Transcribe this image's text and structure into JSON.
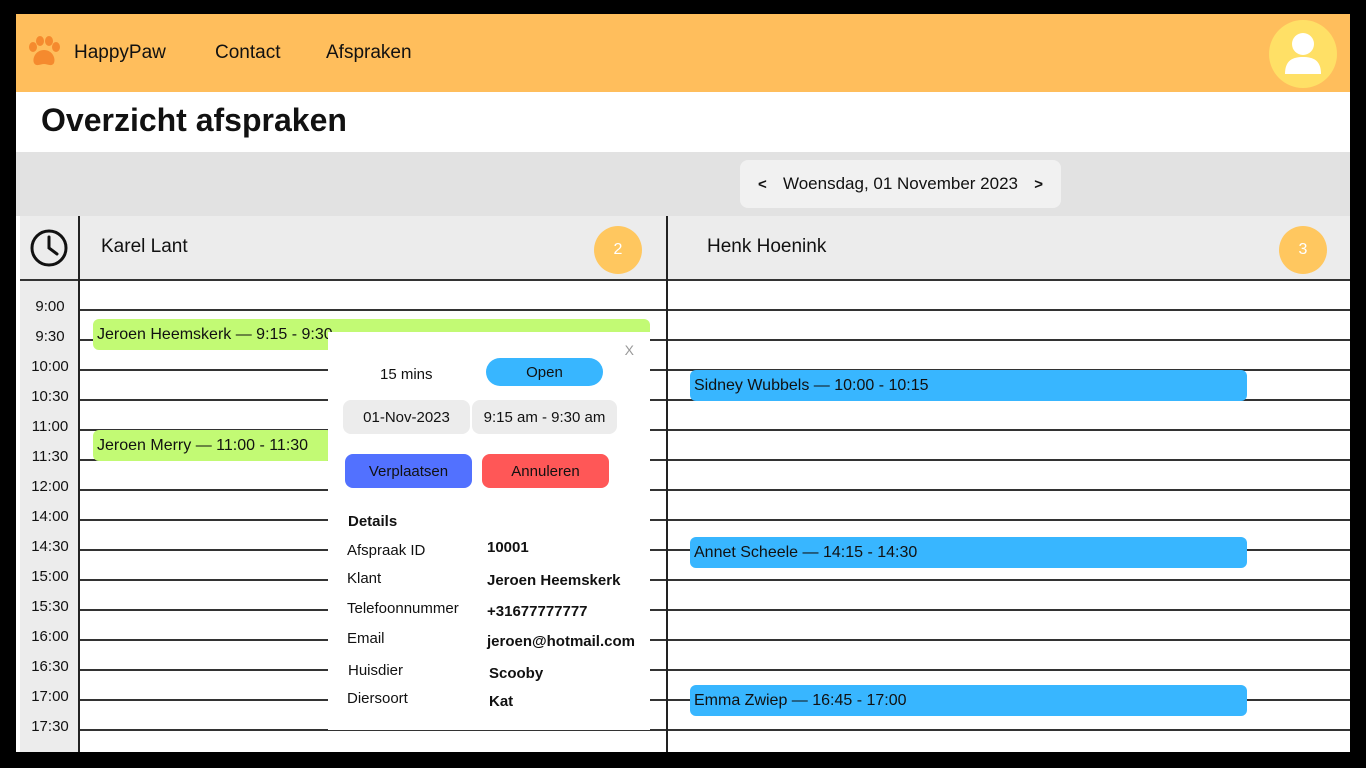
{
  "app": {
    "brand": "HappyPaw"
  },
  "nav": {
    "contact": "Contact",
    "afspraken": "Afspraken"
  },
  "page": {
    "title": "Overzicht afspraken"
  },
  "datebar": {
    "prev": "<",
    "date": "Woensdag, 01 November 2023",
    "next": ">"
  },
  "colors": {
    "header": "#ffbe5c",
    "badge": "#ffc75f",
    "green": "#c2fa74",
    "blue": "#38b6ff",
    "move": "#5271ff",
    "cancel": "#ff5757"
  },
  "staff": [
    {
      "name": "Karel Lant",
      "count": "2"
    },
    {
      "name": "Henk Hoenink",
      "count": "3"
    }
  ],
  "times": [
    "9:00",
    "9:30",
    "10:00",
    "10:30",
    "11:00",
    "11:30",
    "12:00",
    "14:00",
    "14:30",
    "15:00",
    "15:30",
    "16:00",
    "16:30",
    "17:00",
    "17:30"
  ],
  "appointments": {
    "karel": [
      {
        "label": "Jeroen Heemskerk — 9:15 - 9:30"
      },
      {
        "label": "Jeroen Merry — 11:00 - 11:30"
      }
    ],
    "henk": [
      {
        "label": "Sidney Wubbels — 10:00 - 10:15"
      },
      {
        "label": "Annet Scheele — 14:15 - 14:30"
      },
      {
        "label": "Emma Zwiep — 16:45 - 17:00"
      }
    ]
  },
  "popup": {
    "close": "X",
    "duration": "15 mins",
    "status": "Open",
    "date": "01-Nov-2023",
    "time": "9:15 am - 9:30 am",
    "move_label": "Verplaatsen",
    "cancel_label": "Annuleren",
    "details_title": "Details",
    "details": [
      {
        "label": "Afspraak ID",
        "value": "10001"
      },
      {
        "label": "Klant",
        "value": "Jeroen Heemskerk"
      },
      {
        "label": "Telefoonnummer",
        "value": "+31677777777"
      },
      {
        "label": "Email",
        "value": "jeroen@hotmail.com"
      },
      {
        "label": "Huisdier",
        "value": "Scooby"
      },
      {
        "label": "Diersoort",
        "value": "Kat"
      }
    ]
  }
}
